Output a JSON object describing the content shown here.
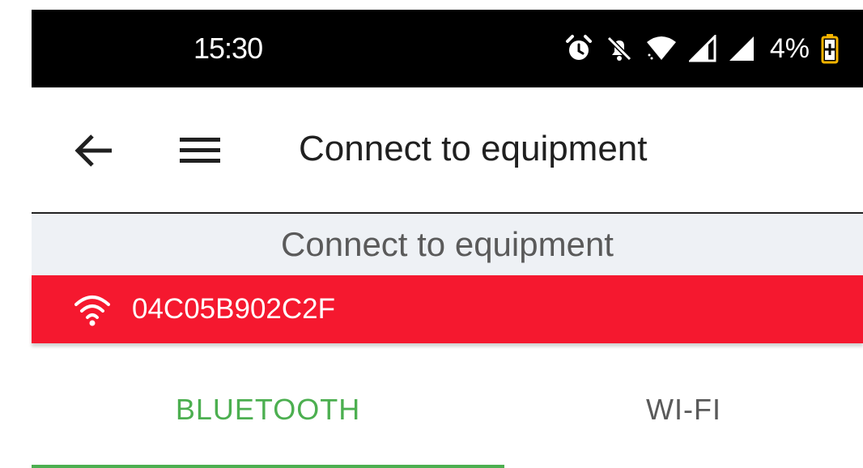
{
  "status_bar": {
    "time": "15:30",
    "icons": [
      "alarm-icon",
      "notifications-off-icon",
      "wifi-signal-icon",
      "cell-signal-icon",
      "cell-signal-icon",
      "battery-charging-icon"
    ],
    "battery_percent": "4%"
  },
  "app_bar": {
    "title": "Connect to equipment",
    "back_icon": "arrow-back-icon",
    "menu_icon": "hamburger-menu-icon"
  },
  "subheader": {
    "title": "Connect to equipment"
  },
  "device_banner": {
    "icon": "wifi-icon",
    "device_id": "04C05B902C2F",
    "background": "#f5182f"
  },
  "tabs": [
    {
      "label": "BLUETOOTH",
      "selected": true,
      "color": "#4caf50"
    },
    {
      "label": "WI-FI",
      "selected": false,
      "color": "#5a5a5a"
    }
  ]
}
